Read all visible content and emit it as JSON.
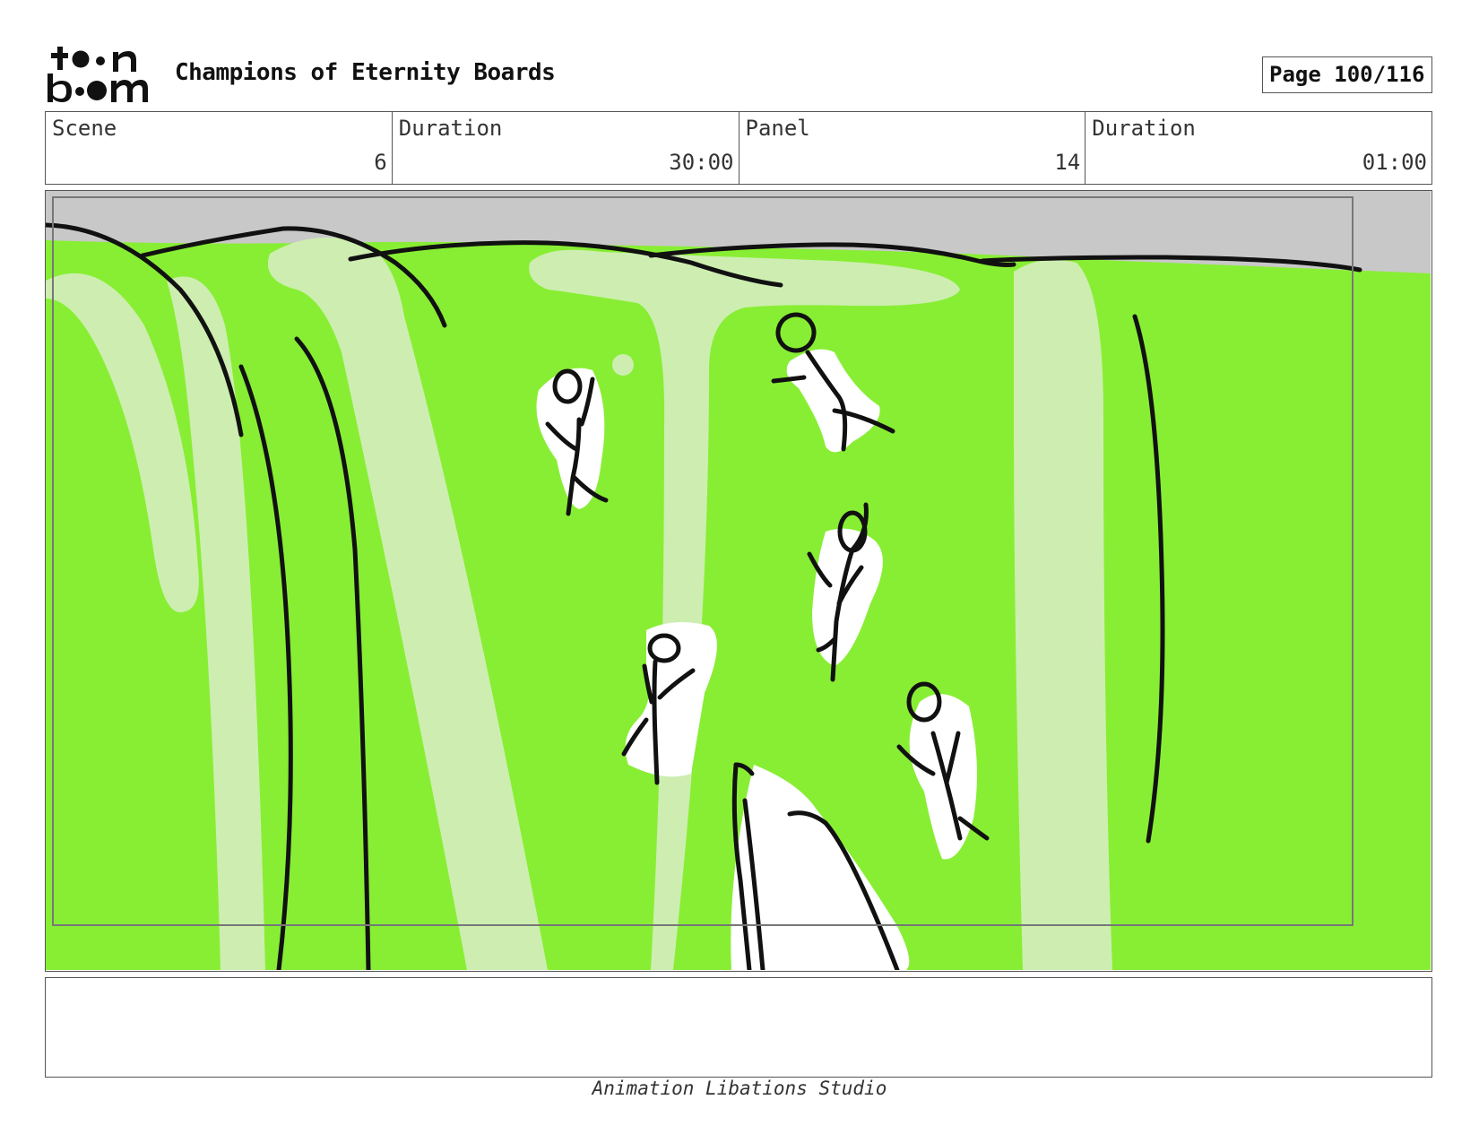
{
  "header": {
    "logo_text": "toon boom",
    "project_title": "Champions of Eternity Boards",
    "page_label": "Page 100/116"
  },
  "info": {
    "scene_label": "Scene",
    "scene_value": "6",
    "scene_duration_label": "Duration",
    "scene_duration_value": "30:00",
    "panel_label": "Panel",
    "panel_value": "14",
    "panel_duration_label": "Duration",
    "panel_duration_value": "01:00"
  },
  "notes": {
    "text": ""
  },
  "footer": {
    "studio": "Animation Libations Studio"
  },
  "colors": {
    "sky_grey": "#c8c8c8",
    "water_green": "#88ee34",
    "foam_light": "#cdeeb0",
    "ink": "#111111"
  }
}
